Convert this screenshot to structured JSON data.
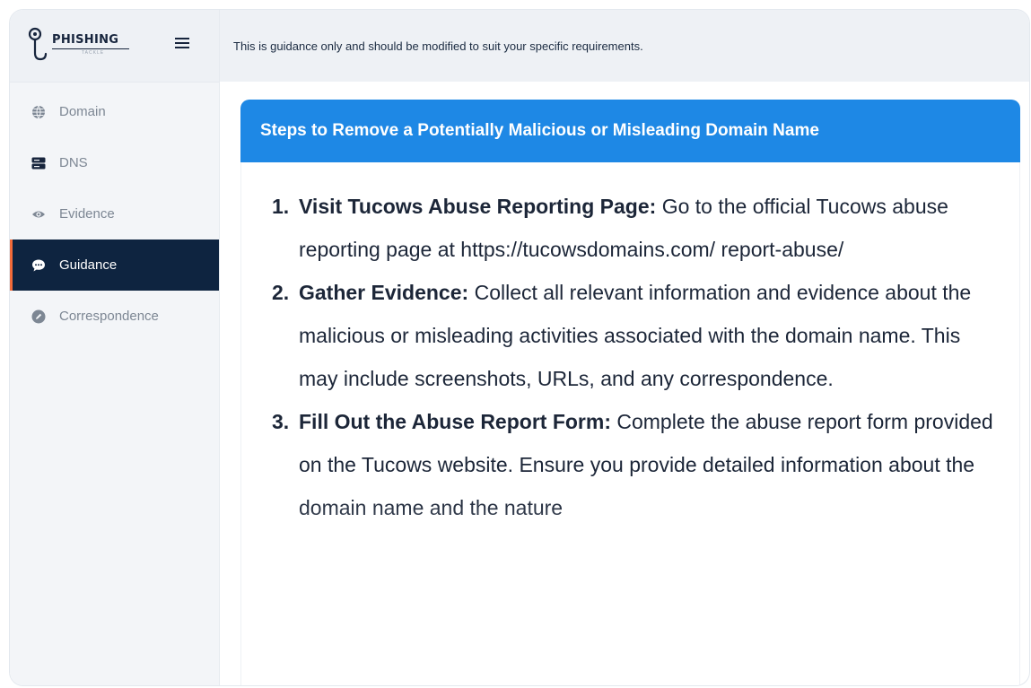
{
  "brand": {
    "name": "PHISHING",
    "sub": "TACKLE"
  },
  "nav": [
    {
      "label": "Domain",
      "icon": "globe-icon",
      "active": false
    },
    {
      "label": "DNS",
      "icon": "server-icon",
      "active": false
    },
    {
      "label": "Evidence",
      "icon": "eye-icon",
      "active": false
    },
    {
      "label": "Guidance",
      "icon": "chat-bubble-icon",
      "active": true
    },
    {
      "label": "Correspondence",
      "icon": "pencil-icon",
      "active": false
    }
  ],
  "topbar": {
    "notice": "This is guidance only and should be modified to suit your specific requirements."
  },
  "card": {
    "title": "Steps to Remove a Potentially Malicious or Misleading Domain Name",
    "steps": [
      {
        "num": "1.",
        "title": "Visit Tucows Abuse Reporting Page:",
        "text": " Go to the official Tucows abuse reporting page at https://tucowsdomains.com/ report-abuse/"
      },
      {
        "num": "2.",
        "title": "Gather Evidence:",
        "text": " Collect all relevant information and evidence about the malicious or misleading activities associated with the domain name. This may include screenshots, URLs, and any correspondence."
      },
      {
        "num": "3.",
        "title": "Fill Out the Abuse Report Form:",
        "text": " Complete the abuse report form provided on the Tucows website. Ensure you provide detailed information about the domain name and the nature"
      }
    ]
  },
  "colors": {
    "nav_active_bg": "#0e2440",
    "nav_active_accent": "#f26b3a",
    "card_header": "#1e88e5"
  }
}
